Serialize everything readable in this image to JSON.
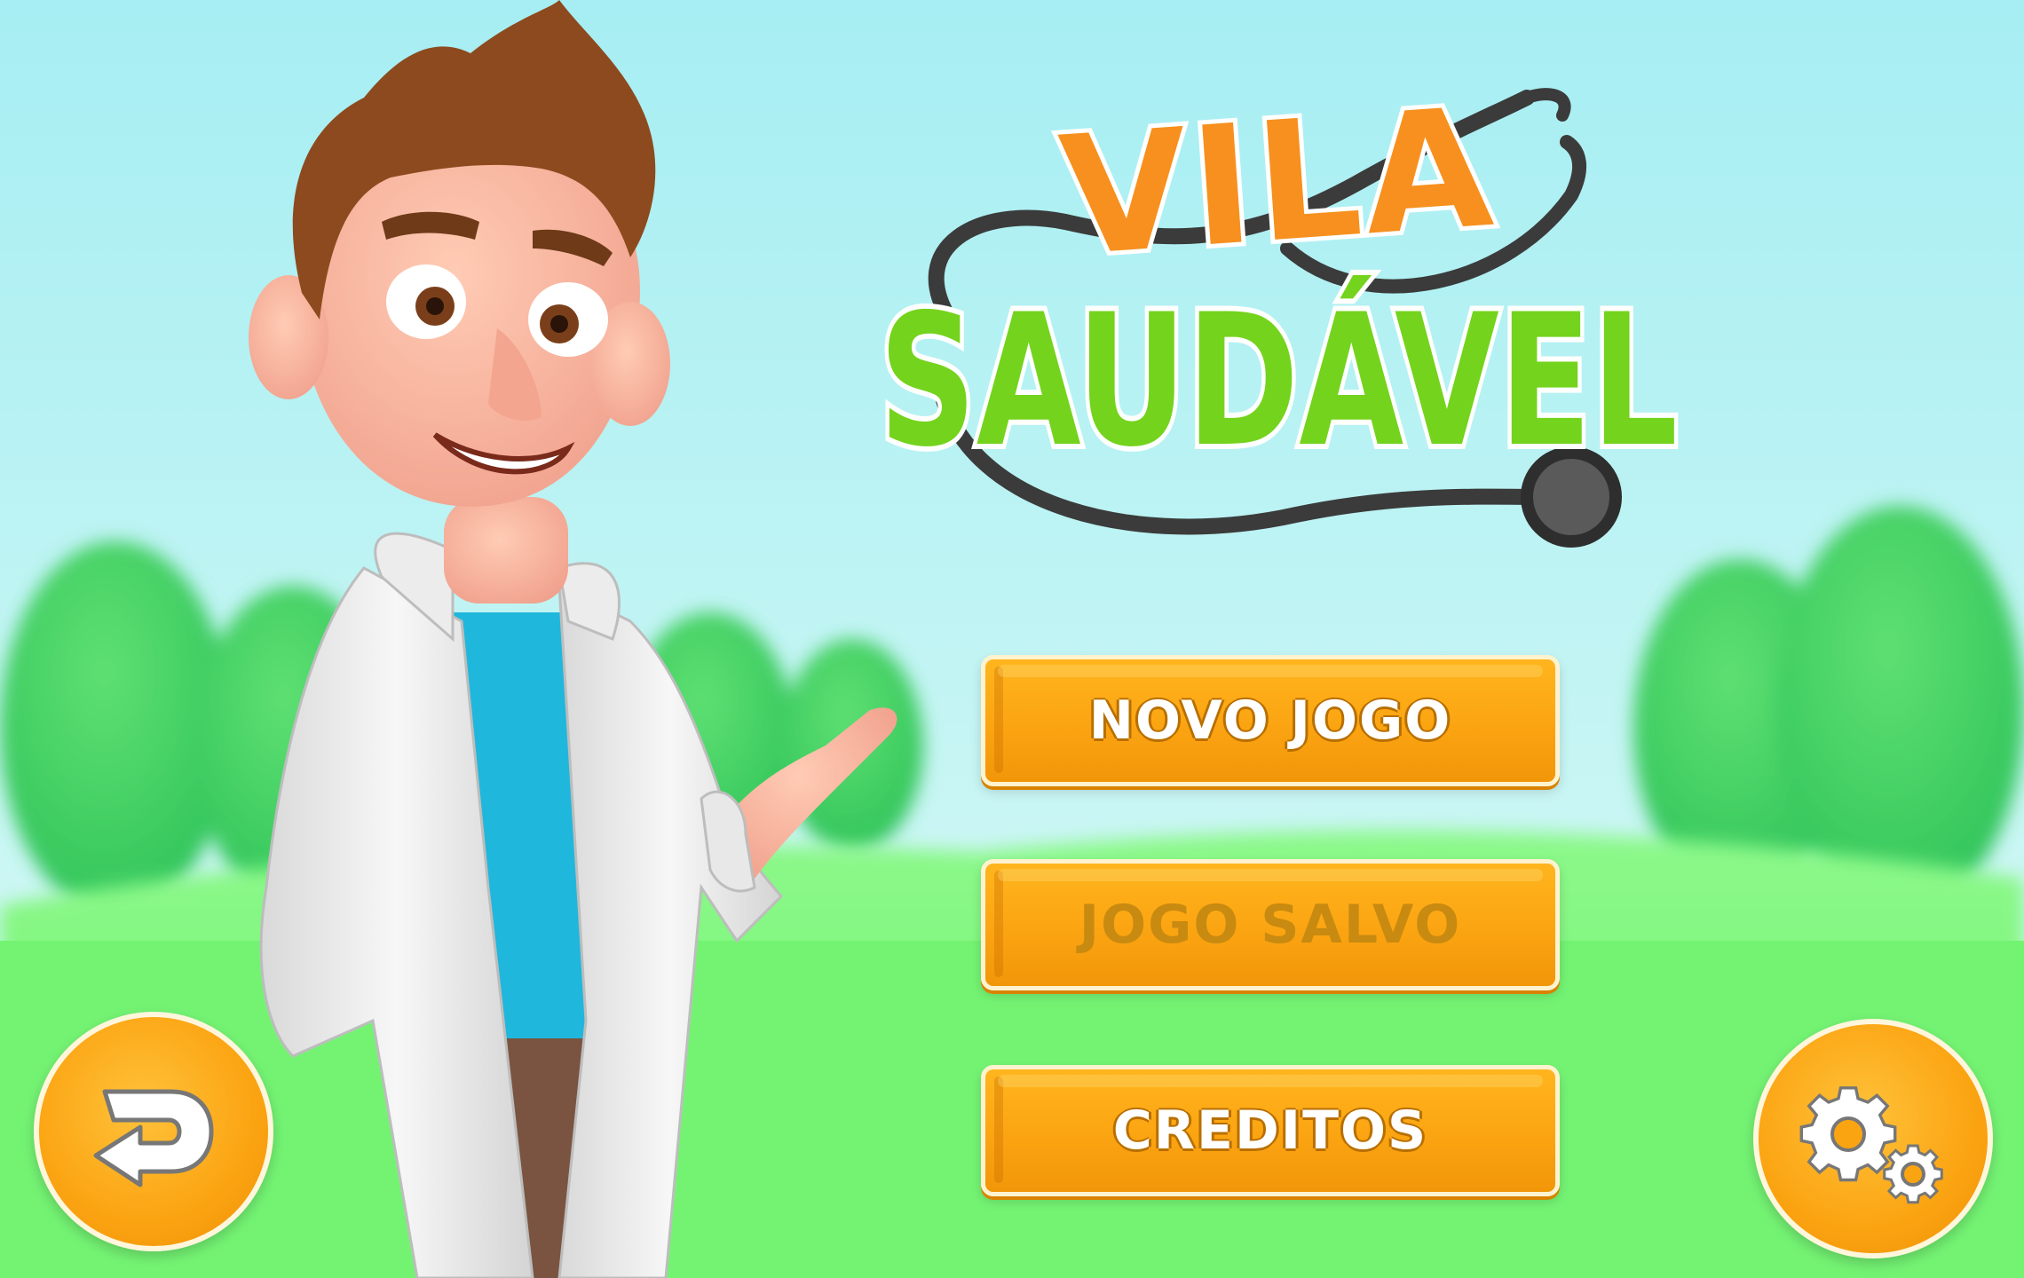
{
  "logo": {
    "line1": "VILA",
    "line2": "SAUDÁVEL"
  },
  "menu": {
    "new_game": "NOVO JOGO",
    "saved_game": "JOGO SALVO",
    "credits": "CREDITOS"
  },
  "icons": {
    "back": "back-arrow-icon",
    "settings": "gears-icon"
  },
  "colors": {
    "button_orange": "#fba412",
    "logo_orange": "#f7901e",
    "logo_green": "#6fd11c",
    "sky": "#a9eef5",
    "grass": "#7cf57e"
  }
}
